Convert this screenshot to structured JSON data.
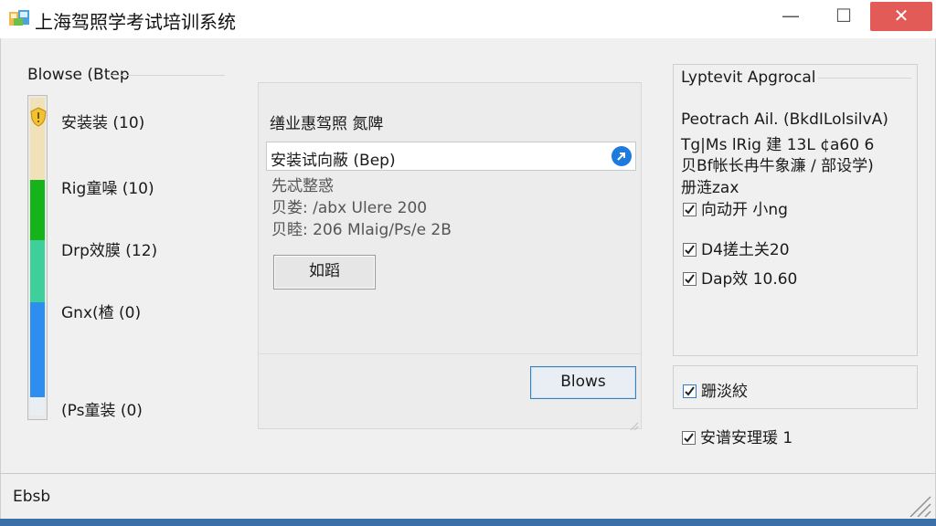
{
  "window": {
    "title": "上海驾照学考试培训系统",
    "minimize_glyph": "—",
    "maximize_glyph": "☐",
    "close_glyph": "✕"
  },
  "left_panel": {
    "group_label": "Blowse (Btep",
    "bar_colors": [
      "#f1e1b8",
      "#17b31a",
      "#3fcf9b",
      "#2e8ef0",
      "#e8eef2"
    ],
    "knob_icon": "warning-shield-icon",
    "categories": [
      {
        "label": "安装装 (10)"
      },
      {
        "label": "Rig童噪 (10)"
      },
      {
        "label": "Drp效膜 (12)"
      },
      {
        "label": "Gnx(楂 (0)"
      },
      {
        "label": "(Ps童装 (0)"
      }
    ]
  },
  "middle_panel": {
    "heading": "缮业惠驾照  氮陴",
    "search_value": "安装试向蔽 (Bep)",
    "go_icon": "arrow-circle-icon",
    "info_lines": [
      "先忒整惑",
      "贝娄:  /abx Ulere 200",
      "贝睦:  206 Mlaig/Ps/e 2B"
    ],
    "open_button": "如蹈",
    "browse_button": "Blows"
  },
  "right_panel": {
    "group_label": "Lyptevit Apgrocal",
    "info_lines": [
      "Peotrach Ail. (BkdILolsilvA)",
      "Tg|Ms lRig  建 13L   ¢a60 6",
      "贝Bf帐长冉牛象濂 / 部设学)",
      "册涟zax"
    ],
    "checks": [
      {
        "label": "向动开 小ng",
        "checked": true
      },
      {
        "label": "D4搓土关20",
        "checked": true
      },
      {
        "label": "Dap效 10.60",
        "checked": true
      }
    ],
    "option_check": {
      "label": "跚淡絞",
      "checked": true
    },
    "bottom_check": {
      "label": "安谱安理瑗 1",
      "checked": true
    }
  },
  "status": {
    "text": "Ebsb"
  },
  "colors": {
    "accent_blue": "#1f7ae0",
    "close_red": "#e35b56"
  }
}
